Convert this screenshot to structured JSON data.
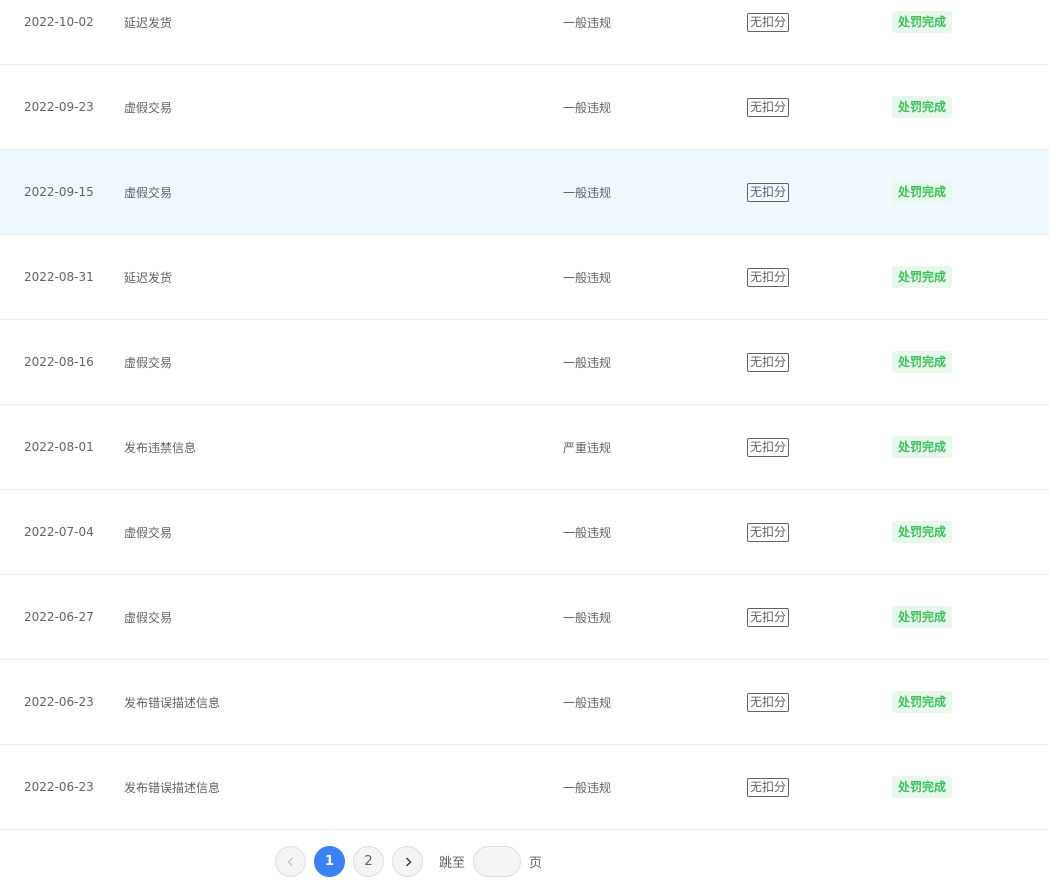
{
  "table": {
    "rows": [
      {
        "date": "2022-10-02",
        "reason": "延迟发货",
        "level": "一般违规",
        "score": "无扣分",
        "status": "处罚完成"
      },
      {
        "date": "2022-09-23",
        "reason": "虚假交易",
        "level": "一般违规",
        "score": "无扣分",
        "status": "处罚完成"
      },
      {
        "date": "2022-09-15",
        "reason": "虚假交易",
        "level": "一般违规",
        "score": "无扣分",
        "status": "处罚完成"
      },
      {
        "date": "2022-08-31",
        "reason": "延迟发货",
        "level": "一般违规",
        "score": "无扣分",
        "status": "处罚完成"
      },
      {
        "date": "2022-08-16",
        "reason": "虚假交易",
        "level": "一般违规",
        "score": "无扣分",
        "status": "处罚完成"
      },
      {
        "date": "2022-08-01",
        "reason": "发布违禁信息",
        "level": "严重违规",
        "score": "无扣分",
        "status": "处罚完成"
      },
      {
        "date": "2022-07-04",
        "reason": "虚假交易",
        "level": "一般违规",
        "score": "无扣分",
        "status": "处罚完成"
      },
      {
        "date": "2022-06-27",
        "reason": "虚假交易",
        "level": "一般违规",
        "score": "无扣分",
        "status": "处罚完成"
      },
      {
        "date": "2022-06-23",
        "reason": "发布错误描述信息",
        "level": "一般违规",
        "score": "无扣分",
        "status": "处罚完成"
      },
      {
        "date": "2022-06-23",
        "reason": "发布错误描述信息",
        "level": "一般违规",
        "score": "无扣分",
        "status": "处罚完成"
      }
    ],
    "hovered_row": 2
  },
  "pagination": {
    "prev_icon": "chevron-left-icon",
    "next_icon": "chevron-right-icon",
    "pages": [
      "1",
      "2"
    ],
    "current_page": "1",
    "jump_label": "跳至",
    "jump_value": "",
    "page_suffix": "页"
  },
  "colors": {
    "primary": "#3b82f6",
    "status_green": "#3bc15b",
    "status_bg": "#e8f8ec",
    "hover_row": "#f0f9fe"
  }
}
